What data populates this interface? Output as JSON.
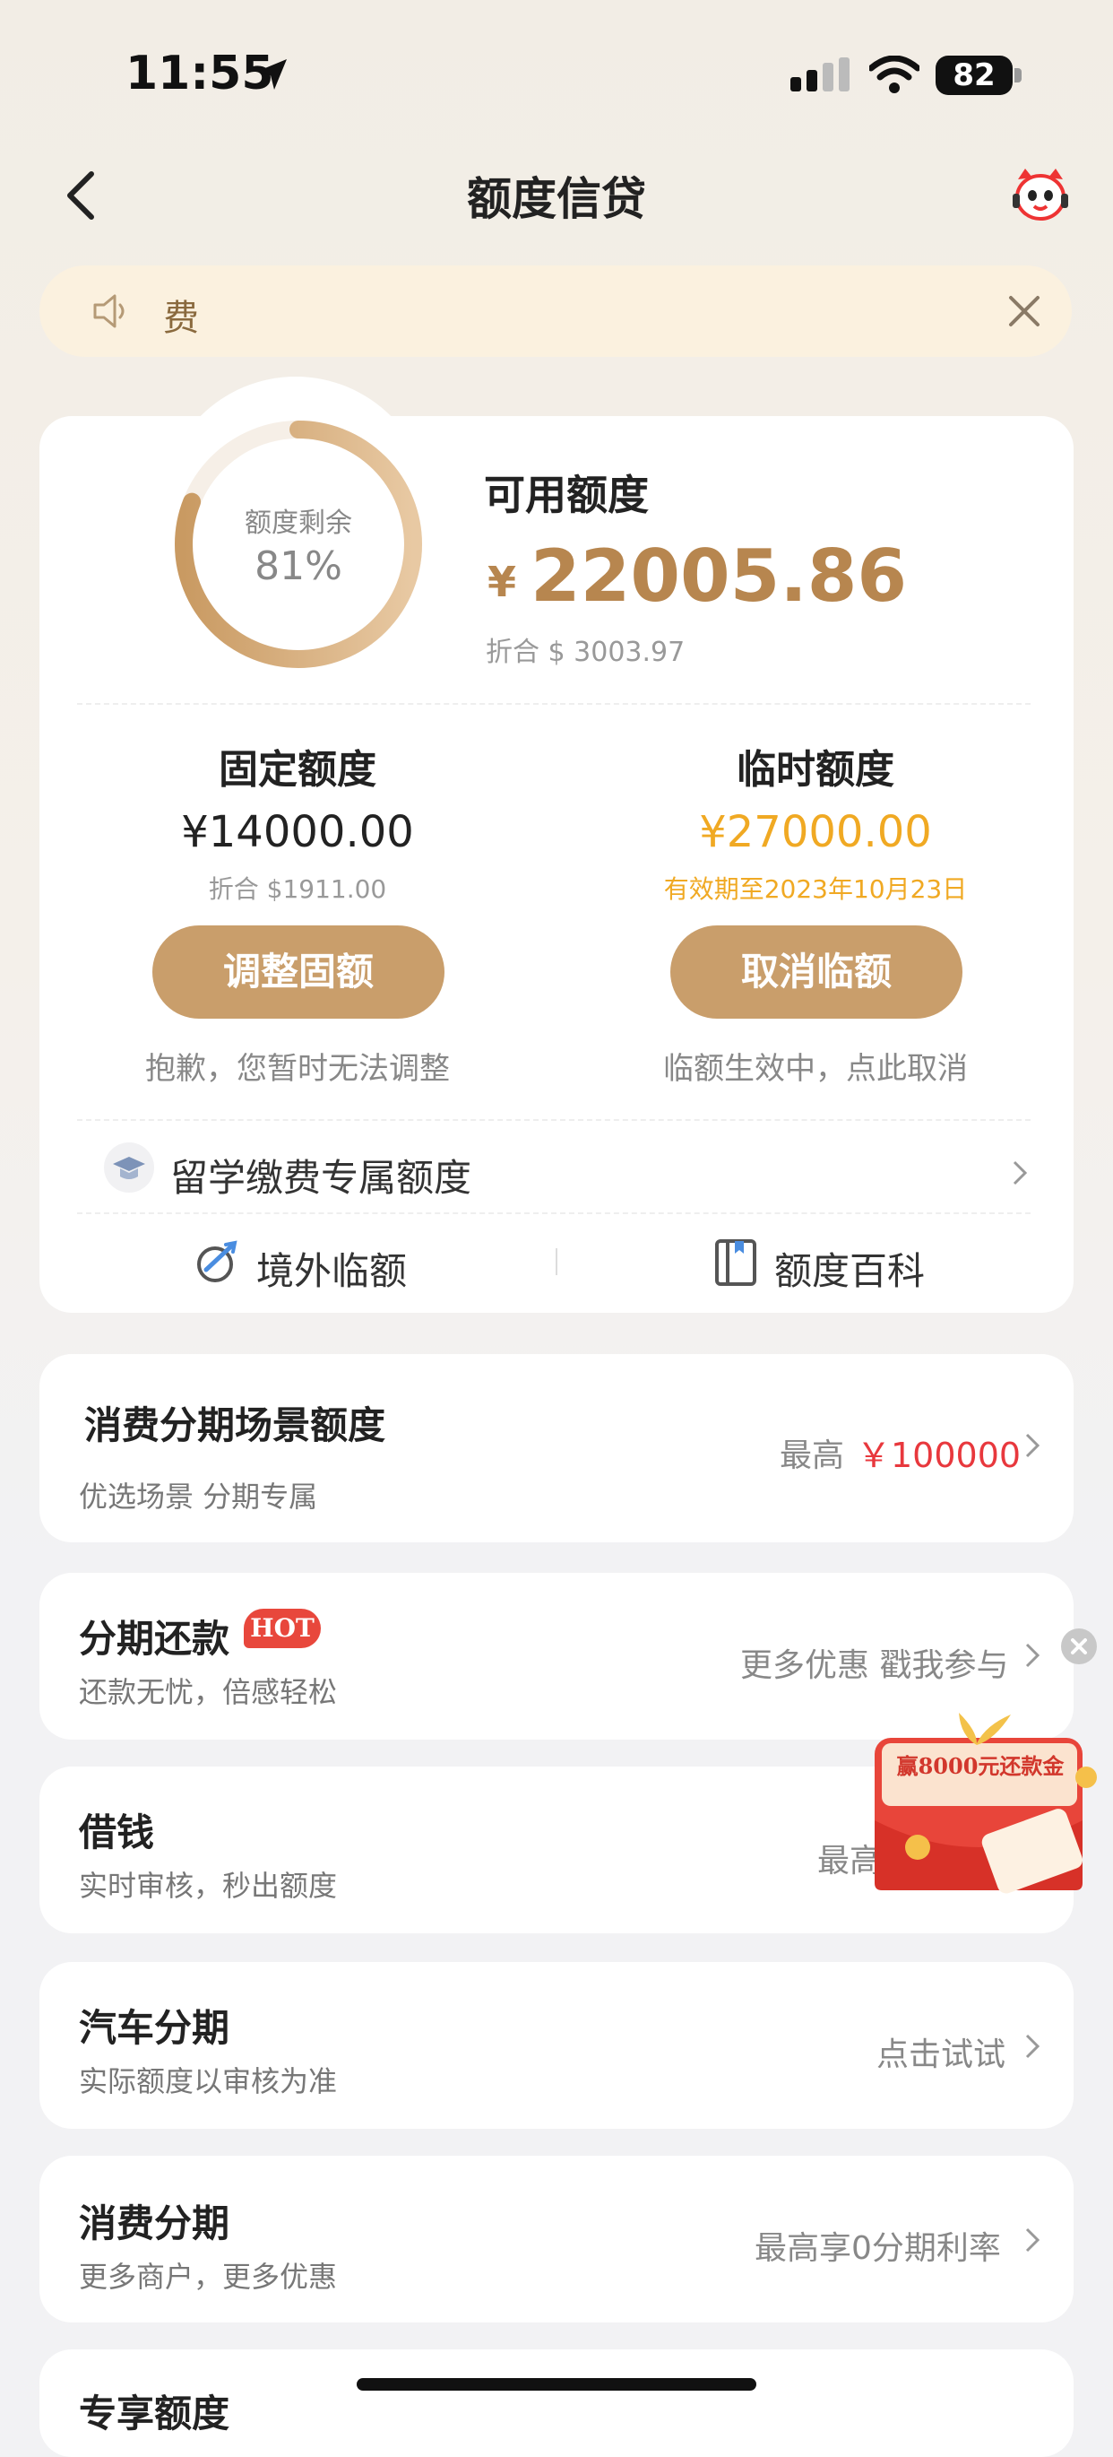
{
  "status_bar": {
    "time": "11:55",
    "battery": "82"
  },
  "nav": {
    "title": "额度信贷"
  },
  "notice": {
    "text": "费"
  },
  "quota": {
    "ring_label": "额度剩余",
    "ring_value": "81%",
    "remaining_fraction": 0.81,
    "available_title": "可用额度",
    "currency_symbol": "¥",
    "available_amount": "22005.86",
    "available_usd": "折合 $ 3003.97",
    "fixed": {
      "title": "固定额度",
      "amount": "¥14000.00",
      "sub": "折合 $1911.00",
      "button": "调整固额",
      "note": "抱歉，您暂时无法调整"
    },
    "temp": {
      "title": "临时额度",
      "amount": "¥27000.00",
      "sub": "有效期至2023年10月23日",
      "button": "取消临额",
      "note": "临额生效中，点此取消"
    },
    "study_abroad": "留学缴费专属额度",
    "overseas": "境外临额",
    "encyclopedia": "额度百科"
  },
  "cards": {
    "scene": {
      "title": "消费分期场景额度",
      "sub": "优选场景 分期专属",
      "right_prefix": "最高",
      "right_value": "￥100000"
    },
    "repay": {
      "title": "分期还款",
      "badge": "HOT",
      "sub": "还款无忧，倍感轻松",
      "right": "更多优惠 戳我参与"
    },
    "borrow": {
      "title": "借钱",
      "sub": "实时审核，秒出额度",
      "right": "最高"
    },
    "car": {
      "title": "汽车分期",
      "sub": "实际额度以审核为准",
      "right": "点击试试"
    },
    "consume": {
      "title": "消费分期",
      "sub": "更多商户，更多优惠",
      "right": "最高享0分期利率"
    },
    "exclusive": {
      "title": "专享额度"
    }
  },
  "promo": {
    "text": "赢8000元还款金"
  },
  "colors": {
    "gold": "#b7864f",
    "button": "#c99e6b",
    "temp_amount": "#f0a923",
    "price_red": "#e8383d"
  }
}
